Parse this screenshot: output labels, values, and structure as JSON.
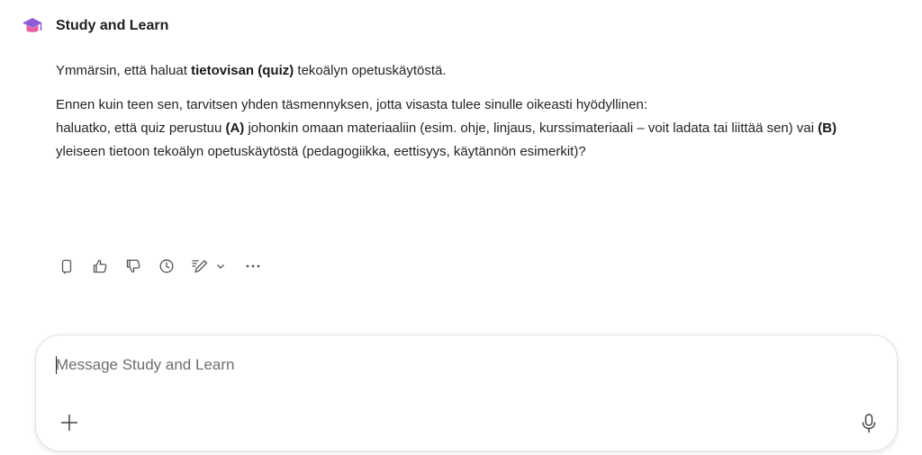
{
  "header": {
    "title": "Study and Learn",
    "icon": "graduation-cap-icon"
  },
  "message": {
    "p1": {
      "before": "Ymmärsin, että haluat ",
      "bold": "tietovisan (quiz)",
      "after": " tekoälyn opetuskäytöstä."
    },
    "p2": {
      "line1": "Ennen kuin teen sen, tarvitsen yhden täsmennyksen, jotta visasta tulee sinulle oikeasti hyödyllinen:",
      "t1": "haluatko, että quiz perustuu ",
      "a": "(A)",
      "t2": " johonkin omaan materiaaliin (esim. ohje, linjaus, kurssimateriaali – voit ladata tai liittää sen) vai ",
      "b": "(B)",
      "t3": " yleiseen tietoon tekoälyn opetuskäytöstä (pedagogiikka, eettisyys, käytännön esimerkit)?"
    }
  },
  "actions": [
    "copy-icon",
    "thumbs-up-icon",
    "thumbs-down-icon",
    "history-icon",
    "edit-icon",
    "chevron-down-icon",
    "more-icon"
  ],
  "composer": {
    "placeholder": "Message Study and Learn",
    "value": ""
  },
  "colors": {
    "cap_primary": "#8e5cd9",
    "cap_accent": "#e85d9c",
    "icon": "#555555"
  }
}
